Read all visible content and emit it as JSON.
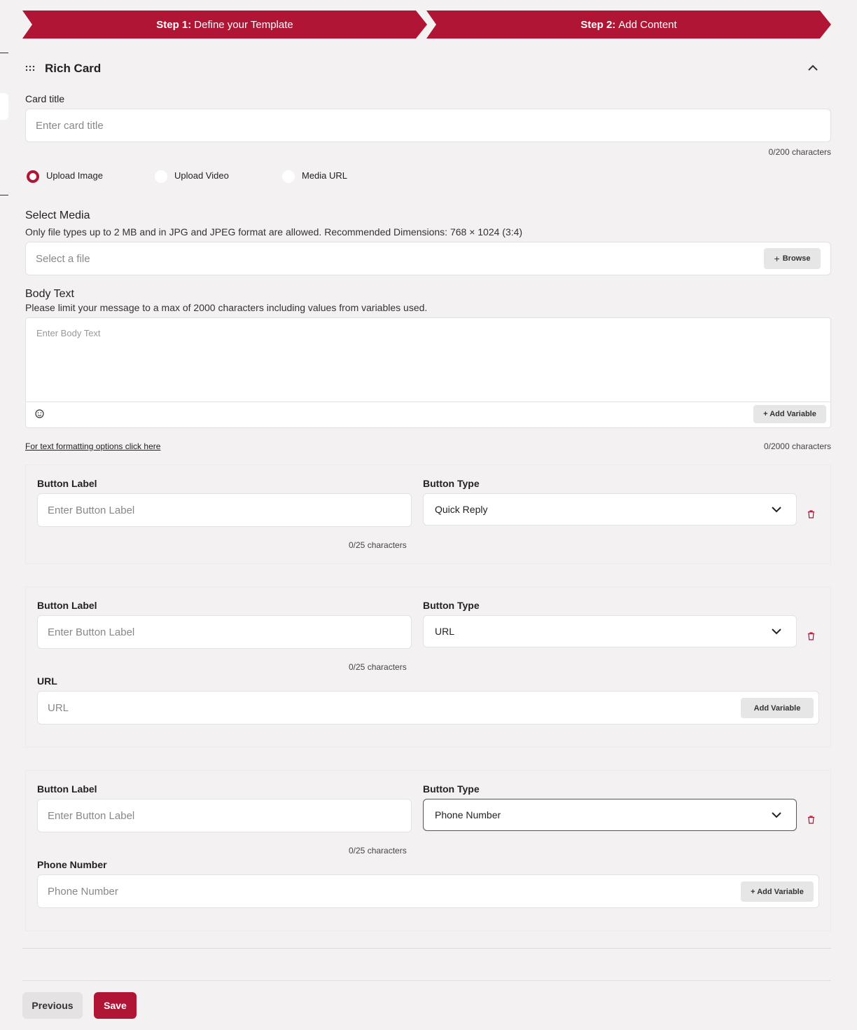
{
  "stepper": {
    "step1_prefix": "Step 1:",
    "step1_label": "Define your Template",
    "step2_prefix": "Step 2:",
    "step2_label": "Add Content"
  },
  "card": {
    "title": "Rich Card",
    "card_title_label": "Card title",
    "card_title_placeholder": "Enter card title",
    "card_title_counter": "0/200 characters"
  },
  "media_options": {
    "selected": "Upload Image",
    "options": [
      "Upload Image",
      "Upload Video",
      "Media URL"
    ]
  },
  "select_media": {
    "title": "Select Media",
    "help": "Only file types up to 2 MB and in JPG and JPEG format are allowed. Recommended Dimensions: 768 × 1024 (3:4)",
    "placeholder": "Select a file",
    "browse_label": "Browse"
  },
  "body_text": {
    "title": "Body Text",
    "help": "Please limit your message to a max of 2000 characters including values from variables used.",
    "placeholder": "Enter Body Text",
    "add_variable_label": "+ Add Variable",
    "formatting_link": "For text formatting options click here",
    "counter": "0/2000 characters"
  },
  "buttons": [
    {
      "label_title": "Button Label",
      "label_placeholder": "Enter Button Label",
      "counter": "0/25 characters",
      "type_title": "Button Type",
      "type_value": "Quick Reply"
    },
    {
      "label_title": "Button Label",
      "label_placeholder": "Enter Button Label",
      "counter": "0/25 characters",
      "type_title": "Button Type",
      "type_value": "URL",
      "extra_title": "URL",
      "extra_placeholder": "URL",
      "extra_add_variable": "Add Variable"
    },
    {
      "label_title": "Button Label",
      "label_placeholder": "Enter Button Label",
      "counter": "0/25 characters",
      "type_title": "Button Type",
      "type_value": "Phone Number",
      "extra_title": "Phone Number",
      "extra_placeholder": "Phone Number",
      "extra_add_variable": "+ Add Variable"
    }
  ],
  "footer": {
    "previous_label": "Previous",
    "save_label": "Save"
  },
  "colors": {
    "accent": "#b01535",
    "background": "#f3f1f1"
  }
}
